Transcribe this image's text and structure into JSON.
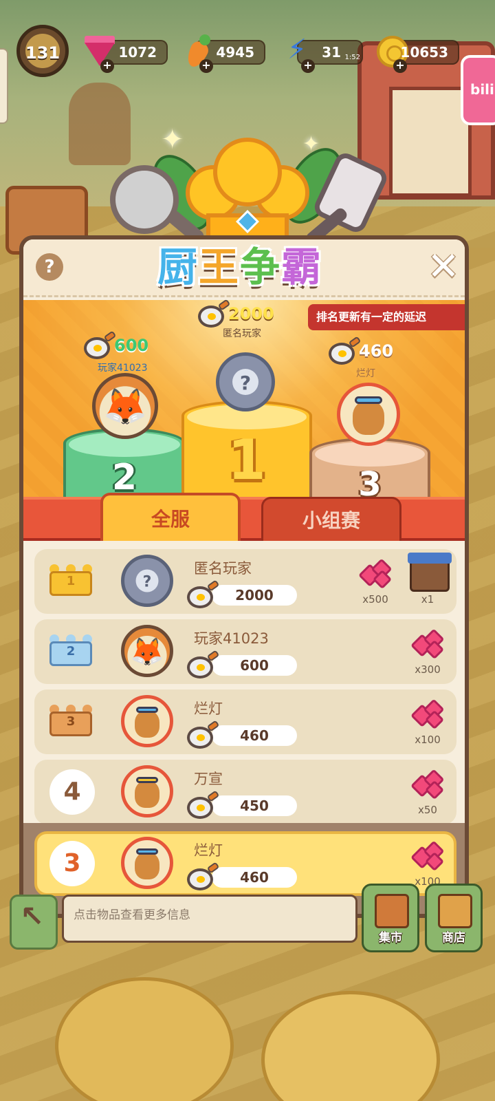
{
  "top_bar": {
    "level": "131",
    "gems": "1072",
    "carrots": "4945",
    "energy": "31",
    "energy_timer": "1:52",
    "coins": "10653",
    "side_badge": "bili"
  },
  "panel": {
    "title": [
      "厨",
      "王",
      "争",
      "霸"
    ],
    "help_label": "?",
    "close_label": "✕",
    "notice": "排名更新有一定的延迟"
  },
  "podium": {
    "first": {
      "name": "匿名玩家",
      "score": "2000",
      "place": "1"
    },
    "second": {
      "name": "玩家41023",
      "score": "600",
      "place": "2"
    },
    "third": {
      "name": "烂灯",
      "score": "460",
      "place": "3"
    }
  },
  "tabs": {
    "all_server": "全服",
    "group": "小组赛"
  },
  "leaderboard": [
    {
      "rank": "1",
      "name": "匿名玩家",
      "score": "2000",
      "rewards": [
        "x500",
        "x1"
      ]
    },
    {
      "rank": "2",
      "name": "玩家41023",
      "score": "600",
      "rewards": [
        "x300"
      ]
    },
    {
      "rank": "3",
      "name": "烂灯",
      "score": "460",
      "rewards": [
        "x100"
      ]
    },
    {
      "rank": "4",
      "name": "万宣",
      "score": "450",
      "rewards": [
        "x50"
      ]
    }
  ],
  "my_rank": {
    "rank": "3",
    "name": "烂灯",
    "score": "460",
    "reward": "x100"
  },
  "bottom": {
    "info_text": "点击物品查看更多信息",
    "market_label": "集市",
    "shop_label": "商店"
  }
}
